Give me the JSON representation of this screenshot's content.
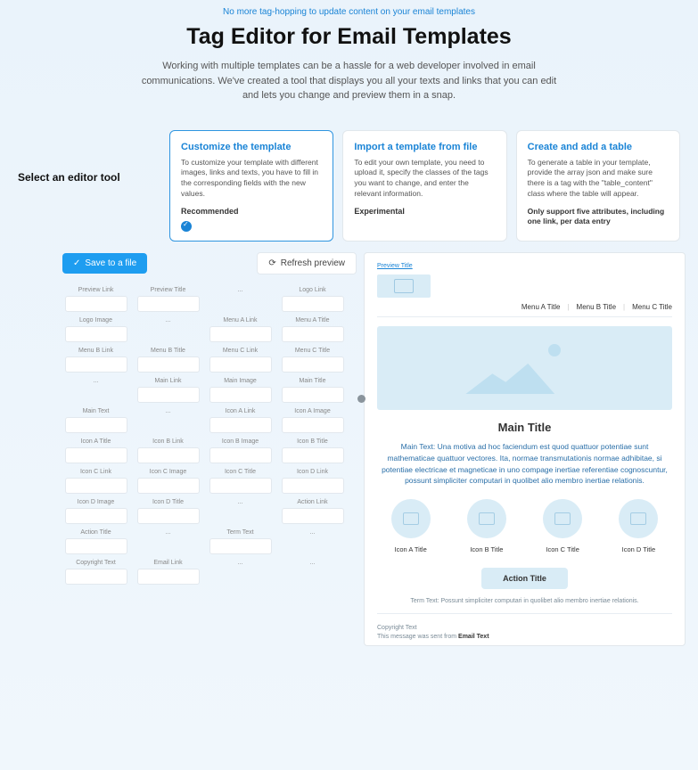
{
  "hero": {
    "tagline": "No more tag-hopping to update content on your email templates",
    "title": "Tag Editor for Email Templates",
    "subtitle": "Working with multiple templates can be a hassle for a web developer involved in email communications. We've created a tool that displays you all your texts and links that you can edit and lets you change and preview them in a snap."
  },
  "selector": {
    "label": "Select an editor tool",
    "cards": [
      {
        "title": "Customize the template",
        "desc": "To customize your template with different images, links and texts, you have to fill in the corresponding fields with the new values.",
        "status": "Recommended",
        "selected": true
      },
      {
        "title": "Import a template from file",
        "desc": "To edit your own template, you need to upload it, specify the classes of the tags you want to change, and enter the relevant information.",
        "status": "Experimental",
        "selected": false
      },
      {
        "title": "Create and add a table",
        "desc": "To generate a table in your template, provide the array json and make sure there is a tag with the \"table_content\" class where the table will appear.",
        "note": "Only support five attributes, including one link, per data entry",
        "selected": false
      }
    ]
  },
  "toolbar": {
    "save": "Save to a file",
    "refresh": "Refresh preview"
  },
  "fields": {
    "row1": [
      "Preview Link",
      "Preview Title",
      "",
      "Logo Link"
    ],
    "row2": [
      "Logo Image",
      "",
      "Menu A Link",
      "Menu A Title"
    ],
    "row3": [
      "Menu B Link",
      "Menu B Title",
      "Menu C Link",
      "Menu C Title"
    ],
    "row4": [
      "",
      "Main Link",
      "Main Image",
      "Main Title"
    ],
    "row5": [
      "Main Text",
      "",
      "Icon A Link",
      "Icon A Image"
    ],
    "row6": [
      "Icon A Title",
      "Icon B Link",
      "Icon B Image",
      "Icon B Title"
    ],
    "row7": [
      "Icon C Link",
      "Icon C Image",
      "Icon C Title",
      "Icon D Link"
    ],
    "row8": [
      "Icon D Image",
      "Icon D Title",
      "",
      "Action Link"
    ],
    "row9": [
      "Action Title",
      "",
      "Term Text",
      ""
    ],
    "row10": [
      "Copyright Text",
      "Email Link",
      "",
      ""
    ]
  },
  "preview": {
    "preview_link": "Preview Title",
    "menu": [
      "Menu A Title",
      "Menu B Title",
      "Menu C Title"
    ],
    "main_title": "Main Title",
    "main_text": "Main Text: Una motiva ad hoc faciendum est quod quattuor potentiae sunt mathematicae quattuor vectores. Ita, normae transmutationis normae adhibitae, si potentiae electricae et magneticae in uno compage inertiae referentiae cognoscuntur, possunt simpliciter computari in quolibet alio membro inertiae relationis.",
    "icons": [
      "Icon A Title",
      "Icon B Title",
      "Icon C Title",
      "Icon D Title"
    ],
    "action": "Action Title",
    "term": "Term Text: Possunt simpliciter computari in quolibet alio membro inertiae relationis.",
    "copyright": "Copyright Text",
    "sent_prefix": "This message was sent from ",
    "sent_from": "Email Text"
  }
}
